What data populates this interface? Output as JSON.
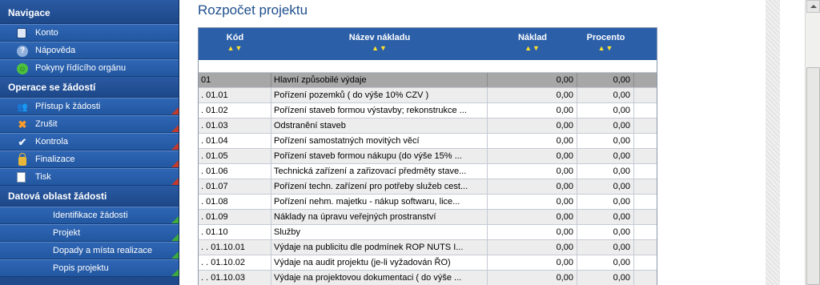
{
  "sidebar": {
    "sections": [
      {
        "title": "Navigace",
        "items": [
          {
            "label": "Konto",
            "icon": "book-icon",
            "corner": ""
          },
          {
            "label": "Nápověda",
            "icon": "help-icon",
            "corner": ""
          },
          {
            "label": "Pokyny řídícího orgánu",
            "icon": "smile-icon",
            "corner": ""
          }
        ]
      },
      {
        "title": "Operace se žádostí",
        "items": [
          {
            "label": "Přístup k žádosti",
            "icon": "people-icon",
            "corner": "red"
          },
          {
            "label": "Zrušit",
            "icon": "cancel-icon",
            "corner": "red"
          },
          {
            "label": "Kontrola",
            "icon": "check-icon",
            "corner": "red"
          },
          {
            "label": "Finalizace",
            "icon": "lock-icon",
            "corner": "red"
          },
          {
            "label": "Tisk",
            "icon": "doc-icon",
            "corner": "red"
          }
        ]
      },
      {
        "title": "Datová oblast žádosti",
        "items": [
          {
            "label": "Identifikace žádosti",
            "icon": "",
            "corner": "green"
          },
          {
            "label": "Projekt",
            "icon": "",
            "corner": "green"
          },
          {
            "label": "Dopady a místa realizace",
            "icon": "",
            "corner": "green"
          },
          {
            "label": "Popis projektu",
            "icon": "",
            "corner": "green"
          }
        ]
      }
    ]
  },
  "main": {
    "title": "Rozpočet projektu",
    "columns": [
      "Kód",
      "Název nákladu",
      "Náklad",
      "Procento"
    ],
    "sort_glyph": "▲▼",
    "rows": [
      {
        "code": "01",
        "name": "Hlavní způsobilé výdaje",
        "cost": "0,00",
        "pct": "0,00",
        "total": true
      },
      {
        "code": ". 01.01",
        "name": "Pořízení pozemků ( do výše 10% CZV )",
        "cost": "0,00",
        "pct": "0,00"
      },
      {
        "code": ". 01.02",
        "name": "Pořízení staveb formou výstavby; rekonstrukce ...",
        "cost": "0,00",
        "pct": "0,00"
      },
      {
        "code": ". 01.03",
        "name": "Odstranění staveb",
        "cost": "0,00",
        "pct": "0,00"
      },
      {
        "code": ". 01.04",
        "name": "Pořízení samostatných movitých věcí",
        "cost": "0,00",
        "pct": "0,00"
      },
      {
        "code": ". 01.05",
        "name": "Pořízení staveb formou nákupu (do výše 15% ...",
        "cost": "0,00",
        "pct": "0,00"
      },
      {
        "code": ". 01.06",
        "name": "Technická zařízení a zařizovací předměty stave...",
        "cost": "0,00",
        "pct": "0,00"
      },
      {
        "code": ". 01.07",
        "name": "Pořízení techn. zařízení pro potřeby služeb cest...",
        "cost": "0,00",
        "pct": "0,00"
      },
      {
        "code": ". 01.08",
        "name": "Pořízení nehm. majetku - nákup softwaru, lice...",
        "cost": "0,00",
        "pct": "0,00"
      },
      {
        "code": ". 01.09",
        "name": "Náklady na úpravu veřejných prostranství",
        "cost": "0,00",
        "pct": "0,00"
      },
      {
        "code": ". 01.10",
        "name": "Služby",
        "cost": "0,00",
        "pct": "0,00"
      },
      {
        "code": ". . 01.10.01",
        "name": "Výdaje na publicitu dle podmínek ROP NUTS I...",
        "cost": "0,00",
        "pct": "0,00"
      },
      {
        "code": ". . 01.10.02",
        "name": "Výdaje na audit projektu (je-li vyžadován ŘO)",
        "cost": "0,00",
        "pct": "0,00"
      },
      {
        "code": ". . 01.10.03",
        "name": "Výdaje na projektovou dokumentaci ( do výše ...",
        "cost": "0,00",
        "pct": "0,00"
      }
    ]
  }
}
